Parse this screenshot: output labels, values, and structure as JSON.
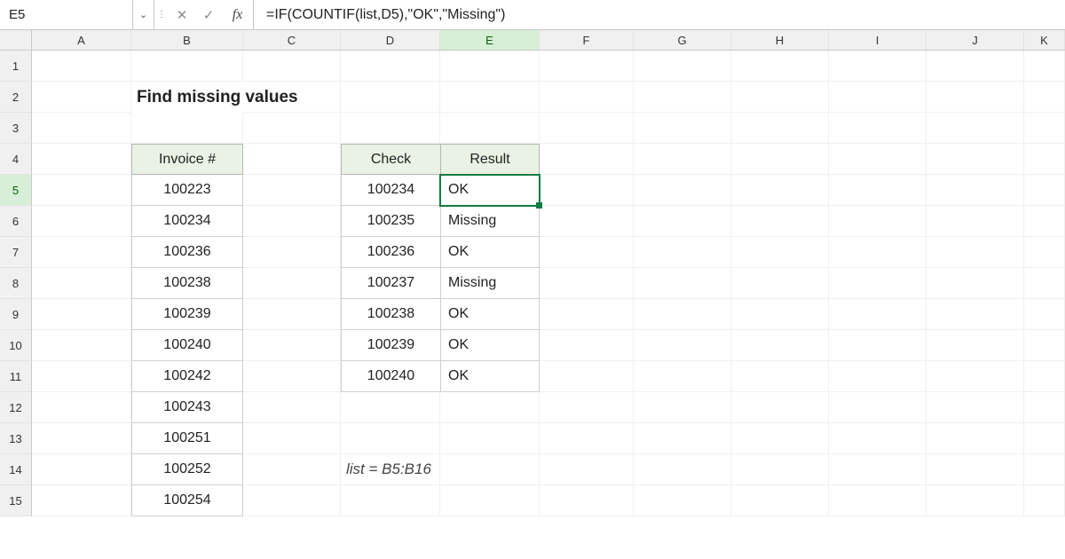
{
  "namebox": "E5",
  "formula": "=IF(COUNTIF(list,D5),\"OK\",\"Missing\")",
  "title": "Find missing values",
  "columns": [
    "A",
    "B",
    "C",
    "D",
    "E",
    "F",
    "G",
    "H",
    "I",
    "J",
    "K"
  ],
  "rows": [
    "1",
    "2",
    "3",
    "4",
    "5",
    "6",
    "7",
    "8",
    "9",
    "10",
    "11",
    "12",
    "13",
    "14",
    "15"
  ],
  "active_col": "E",
  "active_row": "5",
  "tableB": {
    "header": "Invoice #",
    "values": [
      "100223",
      "100234",
      "100236",
      "100238",
      "100239",
      "100240",
      "100242",
      "100243",
      "100251",
      "100252",
      "100254"
    ]
  },
  "tableDE": {
    "headers": {
      "D": "Check",
      "E": "Result"
    },
    "rows": [
      {
        "check": "100234",
        "result": "OK"
      },
      {
        "check": "100235",
        "result": "Missing"
      },
      {
        "check": "100236",
        "result": "OK"
      },
      {
        "check": "100237",
        "result": "Missing"
      },
      {
        "check": "100238",
        "result": "OK"
      },
      {
        "check": "100239",
        "result": "OK"
      },
      {
        "check": "100240",
        "result": "OK"
      }
    ]
  },
  "note": "list = B5:B16",
  "icons": {
    "dropdown": "⌄",
    "cancel": "✕",
    "confirm": "✓",
    "fx": "fx",
    "sep": "⋮"
  }
}
